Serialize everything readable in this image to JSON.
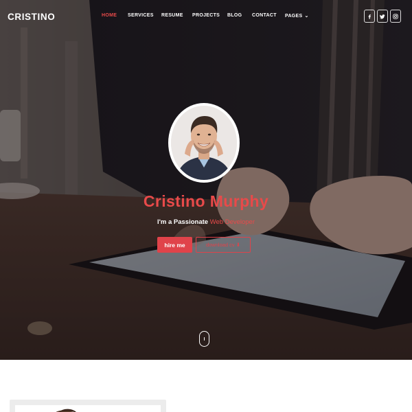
{
  "brand": {
    "name": "CRISTINO"
  },
  "nav": {
    "items": [
      {
        "label": "HOME",
        "active": true
      },
      {
        "label": "SERVICES",
        "active": false
      },
      {
        "label": "RESUME",
        "active": false
      },
      {
        "label": "PROJECTS",
        "active": false
      },
      {
        "label": "BLOG",
        "active": false
      },
      {
        "label": "CONTACT",
        "active": false
      },
      {
        "label": "PAGES",
        "active": false,
        "dropdown": true
      }
    ]
  },
  "social": [
    {
      "icon": "facebook-icon"
    },
    {
      "icon": "twitter-icon"
    },
    {
      "icon": "instagram-icon"
    }
  ],
  "hero": {
    "name": "Cristino Murphy",
    "tagline_prefix": "I'm a Passionate ",
    "tagline_role": "Web Developer",
    "hire_label": "hire me",
    "cv_label": "download cv ⬇"
  },
  "colors": {
    "accent": "#e84a4a",
    "text_light": "#ffffff",
    "hero_overlay": "#120e10"
  }
}
